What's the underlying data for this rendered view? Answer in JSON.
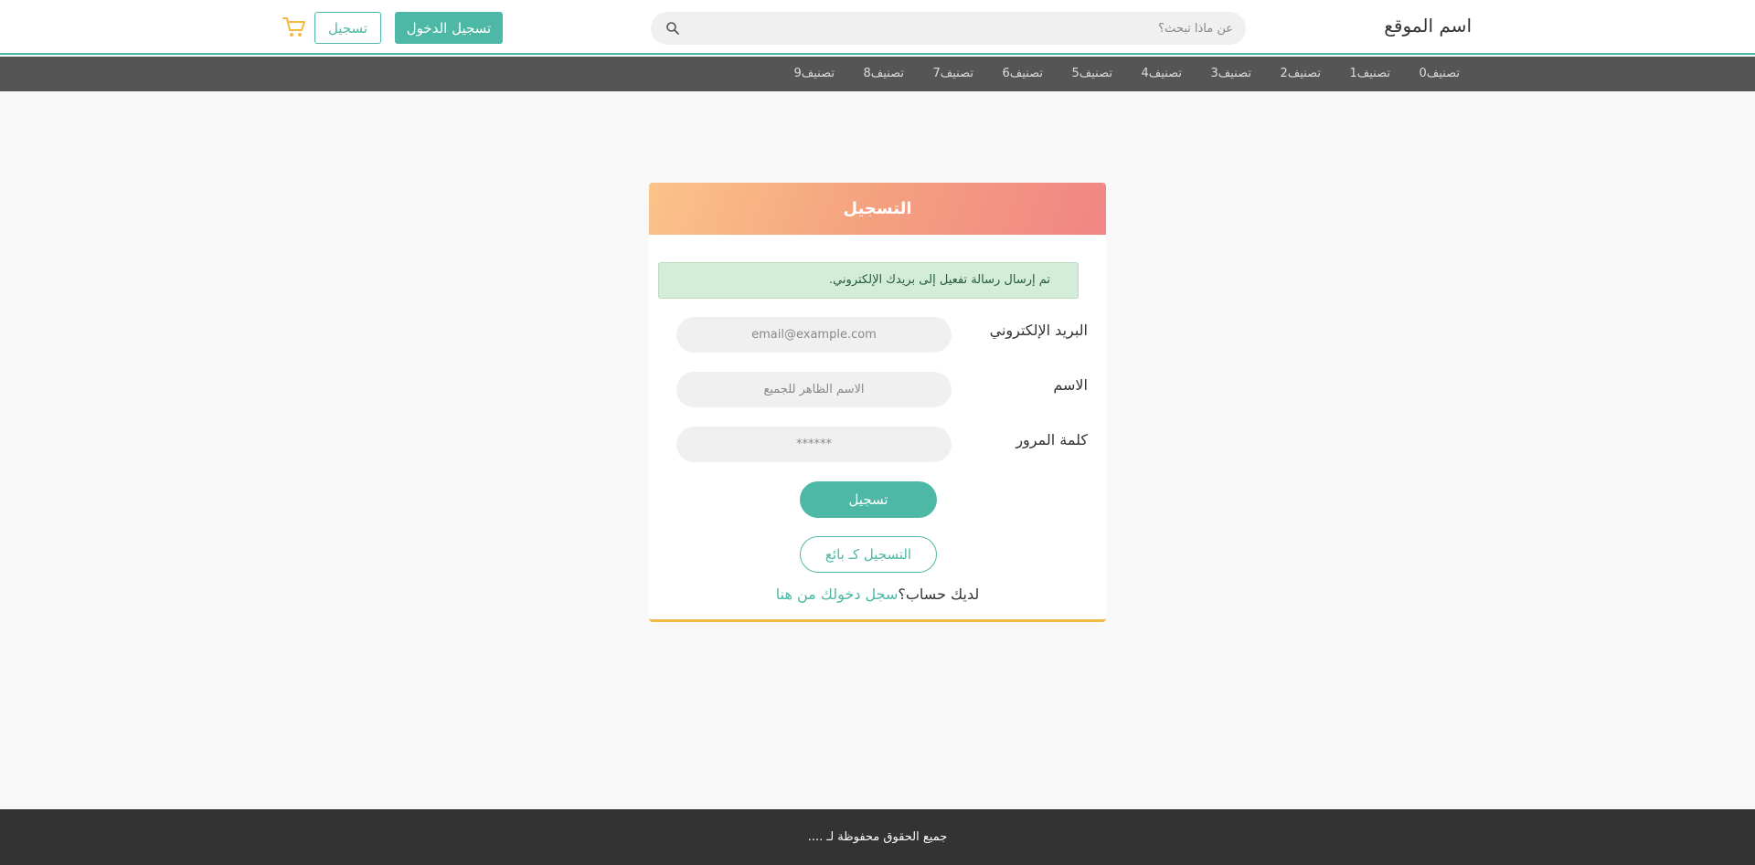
{
  "header": {
    "site_title": "اسم الموقع",
    "search_placeholder": "عن ماذا تبحث؟",
    "login_label": "تسجيل الدخول",
    "register_label": "تسجيل"
  },
  "nav": {
    "items": [
      "تصنيف0",
      "تصنيف1",
      "تصنيف2",
      "تصنيف3",
      "تصنيف4",
      "تصنيف5",
      "تصنيف6",
      "تصنيف7",
      "تصنيف8",
      "تصنيف9"
    ]
  },
  "card": {
    "title": "التسجيل",
    "alert": "تم إرسال رسالة تفعيل إلى بريدك الإلكتروني.",
    "fields": [
      {
        "label": "البريد الإلكتروني",
        "placeholder": "email@example.com"
      },
      {
        "label": "الاسم",
        "placeholder": "الاسم الظاهر للجميع"
      },
      {
        "label": "كلمة المرور",
        "placeholder": "******"
      }
    ],
    "submit_label": "تسجيل",
    "seller_label": "التسجيل كـ بائع",
    "have_account_text": "لديك حساب؟",
    "login_link": "سجل دخولك من هنا"
  },
  "footer": {
    "text": "جميع الحقوق محفوظة لـ ...."
  },
  "colors": {
    "accent": "#4db8a5",
    "nav_bg": "#555555",
    "footer_bg": "#333333",
    "card_border": "#f5b942",
    "cart": "#f5b942"
  },
  "icons": {
    "search": "search-icon",
    "cart": "cart-icon"
  }
}
